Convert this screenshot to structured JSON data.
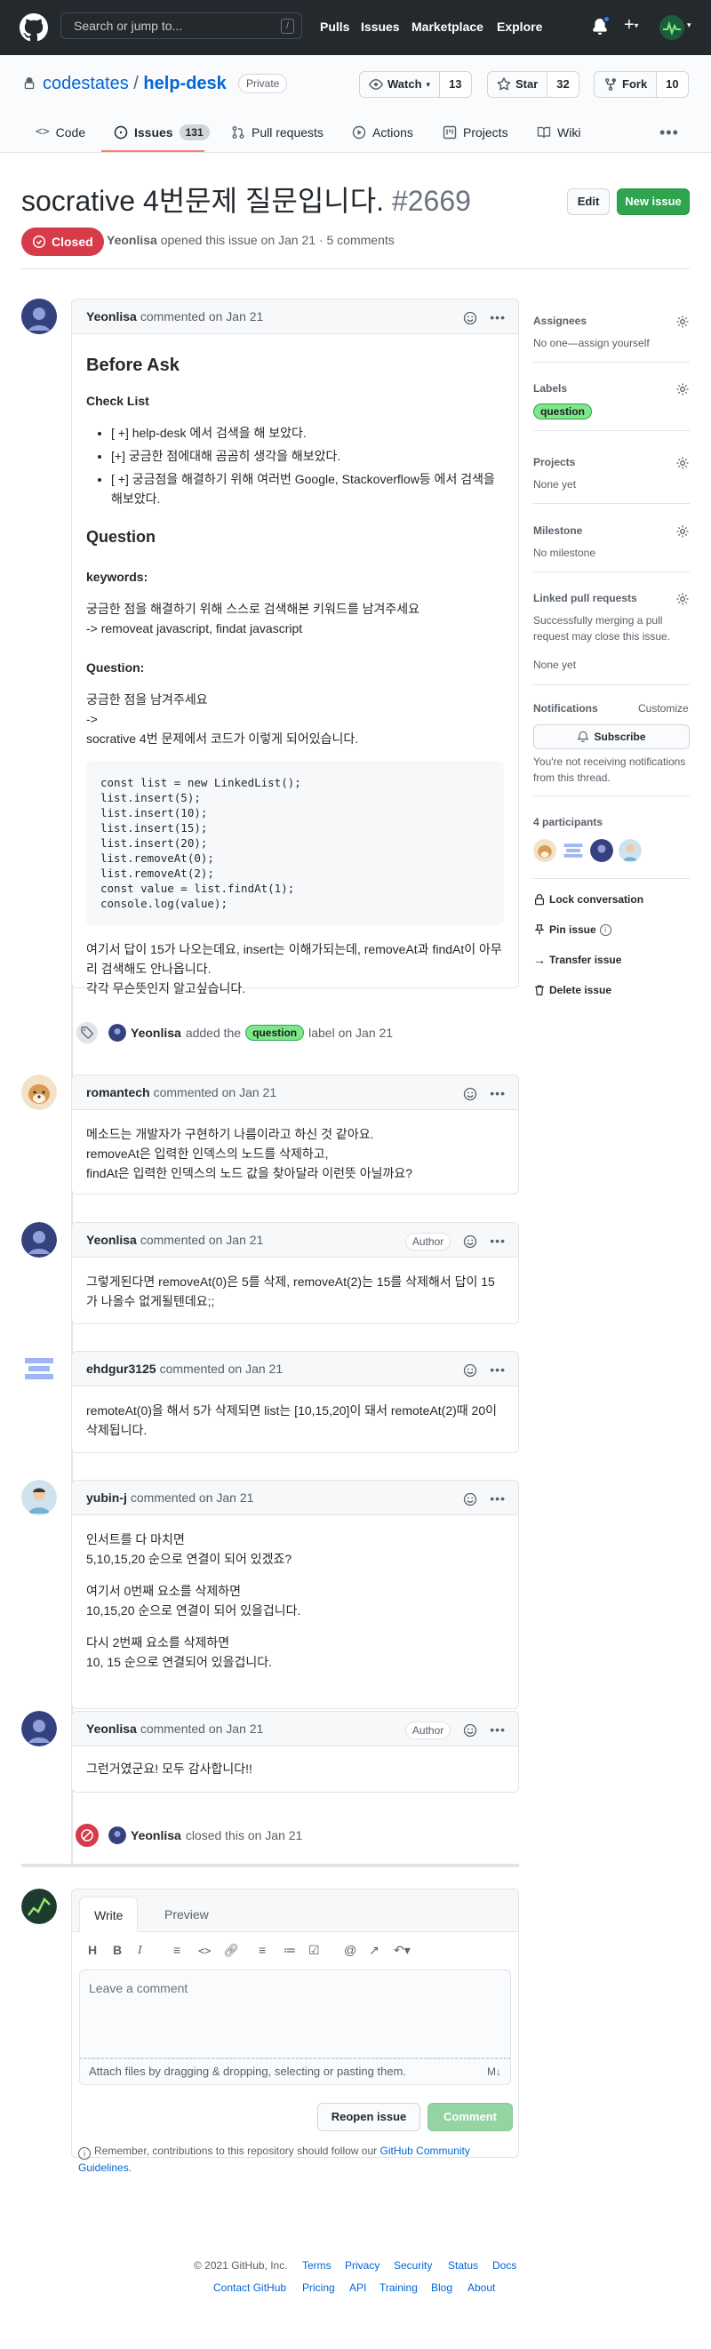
{
  "header": {
    "search_placeholder": "Search or jump to...",
    "search_shortcut": "/",
    "nav": [
      "Pulls",
      "Issues",
      "Marketplace",
      "Explore"
    ]
  },
  "repo": {
    "owner": "codestates",
    "separator": "/",
    "name": "help-desk",
    "visibility": "Private",
    "watch_label": "Watch",
    "watch_count": "13",
    "star_label": "Star",
    "star_count": "32",
    "fork_label": "Fork",
    "fork_count": "10"
  },
  "tabs": {
    "code": "Code",
    "issues": "Issues",
    "issues_count": "131",
    "pulls": "Pull requests",
    "actions": "Actions",
    "projects": "Projects",
    "wiki": "Wiki"
  },
  "issue": {
    "title": "socrative 4번문제 질문입니다.",
    "number": "#2669",
    "state": "Closed",
    "author": "Yeonlisa",
    "meta": "opened this issue on Jan 21 · 5 comments",
    "edit_label": "Edit",
    "new_issue_label": "New issue"
  },
  "first_comment": {
    "author": "Yeonlisa",
    "meta": "commented on Jan 21",
    "h_before": "Before Ask",
    "h_checklist": "Check List",
    "checklist": [
      "[ +] help-desk 에서 검색을 해 보았다.",
      "[+] 궁금한 점에대해 곰곰히 생각을 해보았다.",
      "[ +] 궁금점을 해결하기 위해 여러번 Google, Stackoverflow등 에서 검색을 해보았다."
    ],
    "h_question": "Question",
    "h_keywords": "keywords:",
    "keywords_text_1": "궁금한 점을 해결하기 위해 스스로 검색해본 키워드를 남겨주세요",
    "keywords_text_2": "-> removeat javascript, findat javascript",
    "h_question2": "Question:",
    "question_line_1": "궁금한 점을 남겨주세요",
    "question_line_2": "->",
    "question_line_3": "socrative 4번 문제에서 코드가 이렇게 되어있습니다.",
    "code": "const list = new LinkedList();\nlist.insert(5);\nlist.insert(10);\nlist.insert(15);\nlist.insert(20);\nlist.removeAt(0);\nlist.removeAt(2);\nconst value = list.findAt(1);\nconsole.log(value);",
    "closing_1": "여기서 답이 15가 나오는데요, insert는 이해가되는데, removeAt과 findAt이 아무리 검색해도 안나옵니다.",
    "closing_2": "각각 무슨뜻인지 알고싶습니다."
  },
  "label_event": {
    "actor": "Yeonlisa",
    "before": "added the",
    "label": "question",
    "after": "label on Jan 21"
  },
  "comments": [
    {
      "author": "romantech",
      "meta": "commented on Jan 21",
      "badge": "",
      "lines": [
        "메소드는 개발자가 구현하기 나름이라고 하신 것 같아요.",
        "removeAt은 입력한 인덱스의 노드를 삭제하고,",
        "findAt은 입력한 인덱스의 노드 값을 찾아달라 이런뜻 아닐까요?"
      ]
    },
    {
      "author": "Yeonlisa",
      "meta": "commented on Jan 21",
      "badge": "Author",
      "lines": [
        "그렇게된다면 removeAt(0)은 5를 삭제, removeAt(2)는 15를 삭제해서 답이 15가 나올수 없게될텐데요;;"
      ]
    },
    {
      "author": "ehdgur3125",
      "meta": "commented on Jan 21",
      "badge": "",
      "lines": [
        "remoteAt(0)을 해서 5가 삭제되면 list는 [10,15,20]이 돼서 remoteAt(2)때 20이 삭제됩니다."
      ]
    },
    {
      "author": "yubin-j",
      "meta": "commented on Jan 21",
      "badge": "",
      "paras": [
        [
          "인서트를 다 마치면",
          "5,10,15,20 순으로 연결이 되어 있겠죠?"
        ],
        [
          "여기서 0번째 요소를 삭제하면",
          "10,15,20 순으로 연결이 되어 있을겁니다."
        ],
        [
          "다시 2번째 요소를 삭제하면",
          "10, 15 순으로 연결되어 있을겁니다."
        ]
      ]
    },
    {
      "author": "Yeonlisa",
      "meta": "commented on Jan 21",
      "badge": "Author",
      "lines": [
        "그런거였군요! 모두 감사합니다!!"
      ]
    }
  ],
  "close_event": {
    "actor": "Yeonlisa",
    "text": "closed this on Jan 21"
  },
  "form": {
    "tab_write": "Write",
    "tab_preview": "Preview",
    "placeholder": "Leave a comment",
    "attach": "Attach files by dragging & dropping, selecting or pasting them.",
    "reopen": "Reopen issue",
    "comment": "Comment",
    "note_prefix": "Remember, contributions to this repository should follow our",
    "note_link": "GitHub Community Guidelines",
    "note_suffix": "."
  },
  "sidebar": {
    "assignees_h": "Assignees",
    "assignees_v": "No one—assign yourself",
    "labels_h": "Labels",
    "label": "question",
    "projects_h": "Projects",
    "projects_v": "None yet",
    "milestone_h": "Milestone",
    "milestone_v": "No milestone",
    "linked_h": "Linked pull requests",
    "linked_desc": "Successfully merging a pull request may close this issue.",
    "linked_v": "None yet",
    "notif_h": "Notifications",
    "customize": "Customize",
    "subscribe": "Subscribe",
    "notif_desc": "You're not receiving notifications from this thread.",
    "participants": "4 participants",
    "lock": "Lock conversation",
    "pin": "Pin issue",
    "transfer": "Transfer issue",
    "delete": "Delete issue"
  },
  "footer": {
    "copyright": "© 2021 GitHub, Inc.",
    "row1": [
      "Terms",
      "Privacy",
      "Security",
      "Status",
      "Docs"
    ],
    "row2": [
      "Contact GitHub",
      "Pricing",
      "API",
      "Training",
      "Blog",
      "About"
    ]
  },
  "colors": {
    "header_bg": "#24292e",
    "closed_red": "#d73a49",
    "green": "#2ea44f",
    "link": "#0366d6",
    "label_bg": "#7ee787"
  }
}
